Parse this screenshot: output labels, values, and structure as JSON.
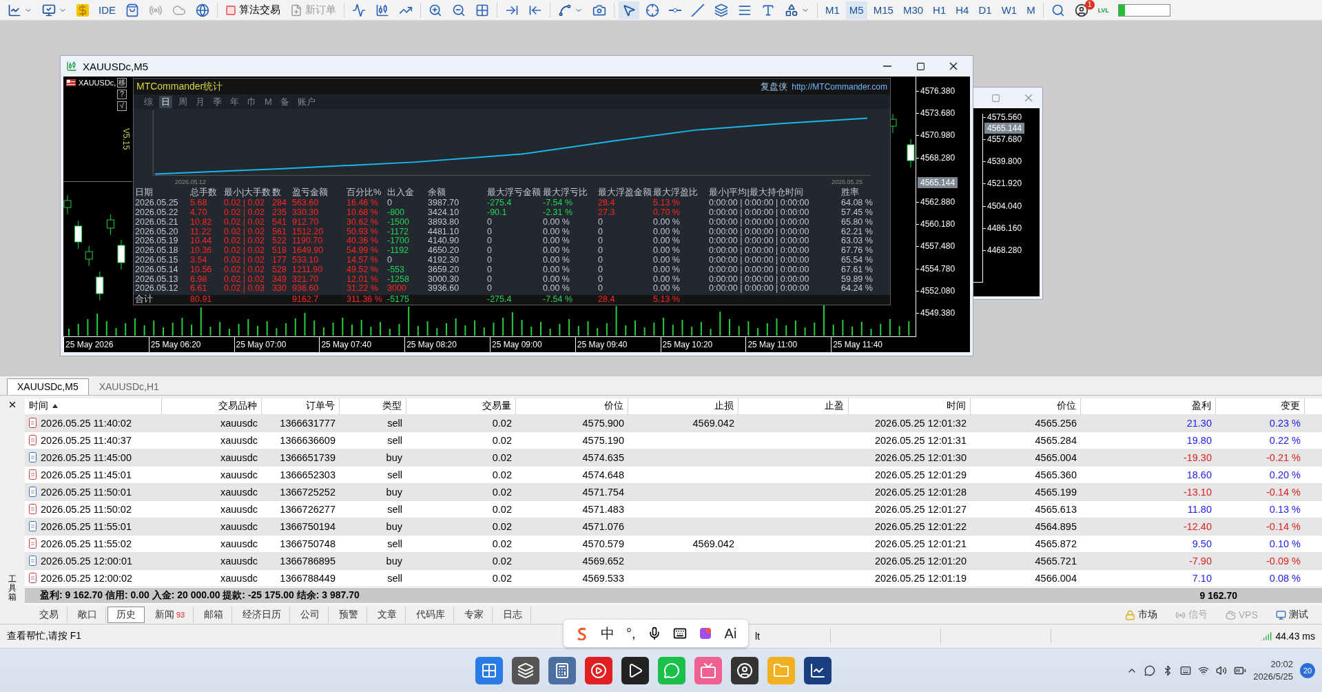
{
  "toolbar": {
    "ide_label": "IDE",
    "algo_trading": {
      "label": "算法交易",
      "on": false
    },
    "new_order": {
      "label": "新订单",
      "disabled": true
    },
    "timeframes": [
      {
        "label": "M1",
        "selected": false
      },
      {
        "label": "M5",
        "selected": true
      },
      {
        "label": "M15",
        "selected": false
      },
      {
        "label": "M30",
        "selected": false
      },
      {
        "label": "H1",
        "selected": false
      },
      {
        "label": "H4",
        "selected": false
      },
      {
        "label": "D1",
        "selected": false
      },
      {
        "label": "W1",
        "selected": false
      },
      {
        "label": "M",
        "selected": false
      }
    ],
    "notification_count": "1",
    "lvl_label": "LVL",
    "meter": {
      "level": 0.12
    }
  },
  "chart_window": {
    "title": "XAUUSDc,M5",
    "symbol_label": "XAUUSDc,",
    "version": "V5.15",
    "side_buttons": [
      "移",
      "?",
      "√"
    ],
    "stats_panel": {
      "title": "MTCommander统计",
      "brand": "复盘侠",
      "url": "http://MTCommander.com",
      "periods": [
        {
          "label": "综",
          "selected": false
        },
        {
          "label": "日",
          "selected": true
        },
        {
          "label": "周",
          "selected": false
        },
        {
          "label": "月",
          "selected": false
        },
        {
          "label": "季",
          "selected": false
        },
        {
          "label": "年",
          "selected": false
        },
        {
          "label": "巾",
          "selected": false
        },
        {
          "label": "M",
          "selected": false
        },
        {
          "label": "备",
          "selected": false
        },
        {
          "label": "账户",
          "selected": false
        }
      ],
      "equity_start_date": "2026.05.12",
      "equity_end_date": "2026.05.25",
      "columns": [
        "日期",
        "总手数",
        "最小|大手数",
        "数",
        "盈亏金额",
        "百分比%",
        "出入金",
        "余额",
        "最大浮亏金额",
        "最大浮亏比",
        "最大浮盈金额",
        "最大浮盈比",
        "最小|平均|最大持仓时间",
        "胜率"
      ],
      "rows": [
        [
          "2026.05.25",
          "5.68",
          "0.02 | 0.02",
          "284",
          "563.60",
          "16.46 %",
          "0",
          "3987.70",
          "-275.4",
          "-7.54 %",
          "28.4",
          "5.13 %",
          "0:00:00 | 0:00:00 | 0:00:00",
          "64.08 %"
        ],
        [
          "2026.05.22",
          "4.70",
          "0.02 | 0.02",
          "235",
          "330.30",
          "10.68 %",
          "-800",
          "3424.10",
          "-90.1",
          "-2.31 %",
          "27.3",
          "0.70 %",
          "0:00:00 | 0:00:00 | 0:00:00",
          "57.45 %"
        ],
        [
          "2026.05.21",
          "10.82",
          "0.02 | 0.02",
          "541",
          "912.70",
          "30.62 %",
          "-1500",
          "3893.80",
          "0",
          "0.00 %",
          "0",
          "0.00 %",
          "0:00:00 | 0:00:00 | 0:00:00",
          "65.80 %"
        ],
        [
          "2026.05.20",
          "11.22",
          "0.02 | 0.02",
          "561",
          "1512.20",
          "50.93 %",
          "-1172",
          "4481.10",
          "0",
          "0.00 %",
          "0",
          "0.00 %",
          "0:00:00 | 0:00:00 | 0:00:00",
          "62.21 %"
        ],
        [
          "2026.05.19",
          "10.44",
          "0.02 | 0.02",
          "522",
          "1190.70",
          "40.36 %",
          "-1700",
          "4140.90",
          "0",
          "0.00 %",
          "0",
          "0.00 %",
          "0:00:00 | 0:00:00 | 0:00:00",
          "63.03 %"
        ],
        [
          "2026.05.18",
          "10.36",
          "0.02 | 0.02",
          "518",
          "1649.90",
          "54.99 %",
          "-1192",
          "4650.20",
          "0",
          "0.00 %",
          "0",
          "0.00 %",
          "0:00:00 | 0:00:00 | 0:00:00",
          "67.76 %"
        ],
        [
          "2026.05.15",
          "3.54",
          "0.02 | 0.02",
          "177",
          "533.10",
          "14.57 %",
          "0",
          "4192.30",
          "0",
          "0.00 %",
          "0",
          "0.00 %",
          "0:00:00 | 0:00:00 | 0:00:00",
          "65.54 %"
        ],
        [
          "2026.05.14",
          "10.56",
          "0.02 | 0.02",
          "528",
          "1211.90",
          "49.52 %",
          "-553",
          "3659.20",
          "0",
          "0.00 %",
          "0",
          "0.00 %",
          "0:00:00 | 0:00:00 | 0:00:00",
          "67.61 %"
        ],
        [
          "2026.05.13",
          "6.98",
          "0.02 | 0.02",
          "349",
          "321.70",
          "12.01 %",
          "-1258",
          "3000.30",
          "0",
          "0.00 %",
          "0",
          "0.00 %",
          "0:00:00 | 0:00:00 | 0:00:00",
          "59.89 %"
        ],
        [
          "2026.05.12",
          "6.61",
          "0.02 | 0.03",
          "330",
          "936.60",
          "31.22 %",
          "3000",
          "3936.60",
          "0",
          "0.00 %",
          "0",
          "0.00 %",
          "0:00:00 | 0:00:00 | 0:00:00",
          "64.24 %"
        ]
      ],
      "total": {
        "label": "合计",
        "lots": "80.91",
        "pnl": "9162.7",
        "pct": "311.36 %",
        "flow": "-5175",
        "max_float_loss": "-275.4",
        "max_float_loss_pct": "-7.54 %",
        "max_float_profit": "28.4",
        "max_float_profit_pct": "5.13 %"
      }
    },
    "price_axis": [
      "4576.380",
      "4573.680",
      "4570.980",
      "4568.280",
      "4562.880",
      "4560.180",
      "4557.480",
      "4554.780",
      "4552.080",
      "4549.380"
    ],
    "current_price": "4565.144",
    "time_axis": [
      "25 May 2026",
      "25 May 06:20",
      "25 May 07:00",
      "25 May 07:40",
      "25 May 08:20",
      "25 May 09:00",
      "25 May 09:40",
      "25 May 10:20",
      "25 May 11:00",
      "25 May 11:40"
    ]
  },
  "background_window": {
    "price_axis": [
      "4575.560",
      "4557.680",
      "4539.800",
      "4521.920",
      "4504.040",
      "4486.160",
      "4468.280"
    ],
    "current_price": "4565.144"
  },
  "chart_tabs": [
    {
      "label": "XAUUSDc,M5",
      "selected": true
    },
    {
      "label": "XAUUSDc,H1",
      "selected": false
    }
  ],
  "history_table": {
    "columns": [
      {
        "label": "时间",
        "sorted": true
      },
      {
        "label": "交易品种",
        "sorted": false
      },
      {
        "label": "订单号",
        "sorted": false
      },
      {
        "label": "类型",
        "sorted": false
      },
      {
        "label": "交易量",
        "sorted": false
      },
      {
        "label": "价位",
        "sorted": false
      },
      {
        "label": "止损",
        "sorted": false
      },
      {
        "label": "止盈",
        "sorted": false
      },
      {
        "label": "时间",
        "sorted": false
      },
      {
        "label": "价位",
        "sorted": false
      },
      {
        "label": "盈利",
        "sorted": false
      },
      {
        "label": "变更",
        "sorted": false
      }
    ],
    "rows": [
      {
        "kind": "sell",
        "open_time": "2026.05.25 11:40:02",
        "symbol": "xauusdc",
        "order": "1366631777",
        "type": "sell",
        "volume": "0.02",
        "open_price": "4575.900",
        "stop_loss": "4569.042",
        "close_time": "2026.05.25 12:01:32",
        "close_price": "4565.256",
        "profit": "21.30",
        "change": "0.23 %"
      },
      {
        "kind": "sell",
        "open_time": "2026.05.25 11:40:37",
        "symbol": "xauusdc",
        "order": "1366636609",
        "type": "sell",
        "volume": "0.02",
        "open_price": "4575.190",
        "close_time": "2026.05.25 12:01:31",
        "close_price": "4565.284",
        "profit": "19.80",
        "change": "0.22 %"
      },
      {
        "kind": "buy",
        "open_time": "2026.05.25 11:45:00",
        "symbol": "xauusdc",
        "order": "1366651739",
        "type": "buy",
        "volume": "0.02",
        "open_price": "4574.635",
        "close_time": "2026.05.25 12:01:30",
        "close_price": "4565.004",
        "profit": "-19.30",
        "change": "-0.21 %"
      },
      {
        "kind": "sell",
        "open_time": "2026.05.25 11:45:01",
        "symbol": "xauusdc",
        "order": "1366652303",
        "type": "sell",
        "volume": "0.02",
        "open_price": "4574.648",
        "close_time": "2026.05.25 12:01:29",
        "close_price": "4565.360",
        "profit": "18.60",
        "change": "0.20 %"
      },
      {
        "kind": "buy",
        "open_time": "2026.05.25 11:50:01",
        "symbol": "xauusdc",
        "order": "1366725252",
        "type": "buy",
        "volume": "0.02",
        "open_price": "4571.754",
        "close_time": "2026.05.25 12:01:28",
        "close_price": "4565.199",
        "profit": "-13.10",
        "change": "-0.14 %"
      },
      {
        "kind": "sell",
        "open_time": "2026.05.25 11:50:02",
        "symbol": "xauusdc",
        "order": "1366726277",
        "type": "sell",
        "volume": "0.02",
        "open_price": "4571.483",
        "close_time": "2026.05.25 12:01:27",
        "close_price": "4565.613",
        "profit": "11.80",
        "change": "0.13 %"
      },
      {
        "kind": "buy",
        "open_time": "2026.05.25 11:55:01",
        "symbol": "xauusdc",
        "order": "1366750194",
        "type": "buy",
        "volume": "0.02",
        "open_price": "4571.076",
        "close_time": "2026.05.25 12:01:22",
        "close_price": "4564.895",
        "profit": "-12.40",
        "change": "-0.14 %"
      },
      {
        "kind": "sell",
        "open_time": "2026.05.25 11:55:02",
        "symbol": "xauusdc",
        "order": "1366750748",
        "type": "sell",
        "volume": "0.02",
        "open_price": "4570.579",
        "stop_loss": "4569.042",
        "close_time": "2026.05.25 12:01:21",
        "close_price": "4565.872",
        "profit": "9.50",
        "change": "0.10 %"
      },
      {
        "kind": "buy",
        "open_time": "2026.05.25 12:00:01",
        "symbol": "xauusdc",
        "order": "1366786895",
        "type": "buy",
        "volume": "0.02",
        "open_price": "4569.652",
        "close_time": "2026.05.25 12:01:20",
        "close_price": "4565.721",
        "profit": "-7.90",
        "change": "-0.09 %"
      },
      {
        "kind": "sell",
        "open_time": "2026.05.25 12:00:02",
        "symbol": "xauusdc",
        "order": "1366788449",
        "type": "sell",
        "volume": "0.02",
        "open_price": "4569.533",
        "close_time": "2026.05.25 12:01:19",
        "close_price": "4566.004",
        "profit": "7.10",
        "change": "0.08 %"
      }
    ]
  },
  "summary": {
    "text": "盈利: 9 162.70 信用: 0.00 入金: 20 000.00 提款: -25 175.00 结余: 3 987.70",
    "profit_total": "9 162.70"
  },
  "toolbox_label": "工具箱",
  "bottom_tabs": [
    {
      "label": "交易",
      "selected": false
    },
    {
      "label": "敞口",
      "selected": false
    },
    {
      "label": "历史",
      "selected": true
    },
    {
      "label": "新闻",
      "selected": false,
      "badge": "93"
    },
    {
      "label": "邮箱",
      "selected": false
    },
    {
      "label": "经济日历",
      "selected": false
    },
    {
      "label": "公司",
      "selected": false
    },
    {
      "label": "预警",
      "selected": false
    },
    {
      "label": "文章",
      "selected": false
    },
    {
      "label": "代码库",
      "selected": false
    },
    {
      "label": "专家",
      "selected": false
    },
    {
      "label": "日志",
      "selected": false
    }
  ],
  "right_tabs": [
    {
      "kind": "market",
      "label": "市场",
      "disabled": false
    },
    {
      "kind": "signal",
      "label": "信号",
      "disabled": true
    },
    {
      "kind": "vps",
      "label": "VPS",
      "disabled": true
    },
    {
      "kind": "tester",
      "label": "测试",
      "disabled": false
    }
  ],
  "status_bar": {
    "help": "查看帮忙,请按 F1",
    "fragment": "lt",
    "ping": "44.43 ms"
  },
  "ime_toolbar": {
    "mode": "中",
    "punctuation": "°,",
    "ai": "Ai"
  },
  "taskbar": {
    "time": "20:02",
    "date": "2026/5/25",
    "notification_count": "20"
  }
}
